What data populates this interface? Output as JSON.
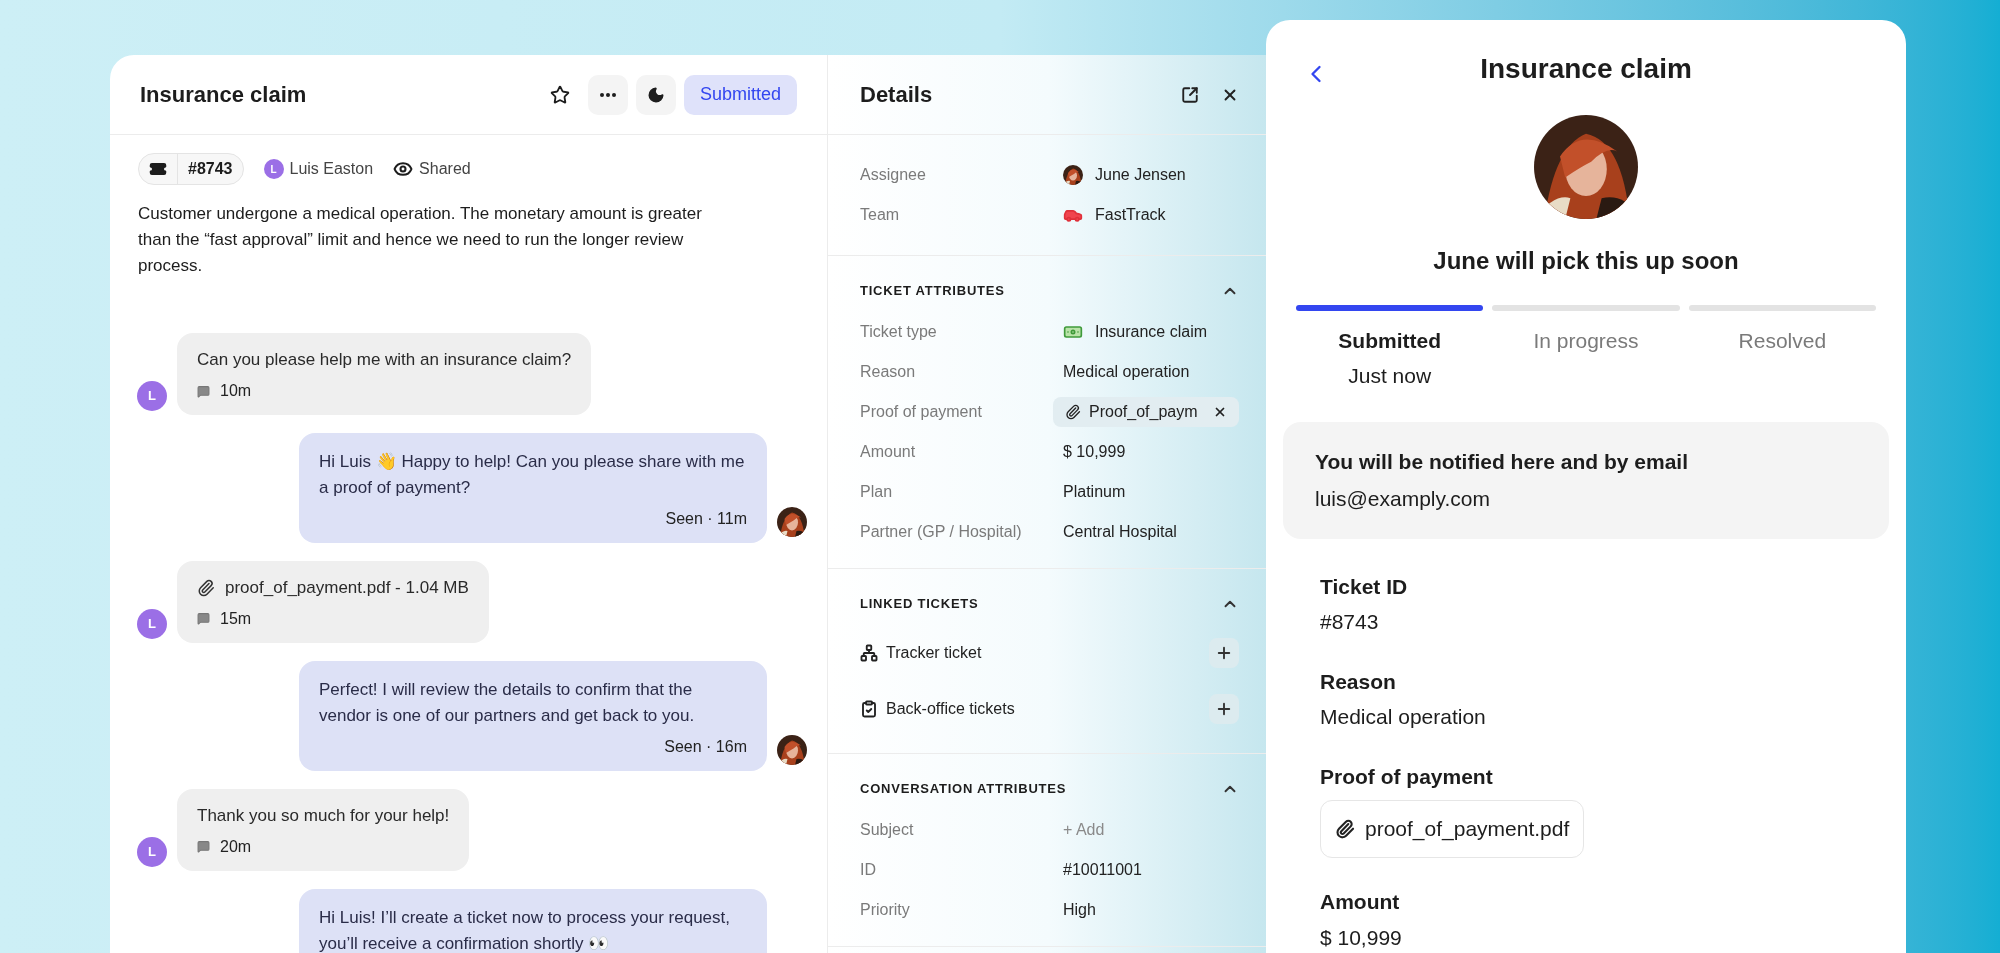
{
  "ticket": {
    "title": "Insurance claim",
    "status_button": "Submitted",
    "id": "#8743",
    "requester": {
      "initial": "L",
      "name": "Luis Easton"
    },
    "visibility": "Shared",
    "starred": false,
    "description": "Customer undergone a medical operation. The monetary amount is greater than the “fast approval” limit and hence we need to run the longer review process."
  },
  "messages": [
    {
      "kind": "customer",
      "avatar": "L",
      "text": "Can you please help me with an insurance claim?",
      "time": "10m"
    },
    {
      "kind": "agent",
      "text": "Hi Luis 👋 Happy to help! Can you please share with me a proof of payment?",
      "meta": "Seen · 11m"
    },
    {
      "kind": "attachment",
      "avatar": "L",
      "text": "proof_of_payment.pdf - 1.04 MB",
      "time": "15m"
    },
    {
      "kind": "agent",
      "text": "Perfect! I will review the details to confirm that the vendor is one of our partners and get back to you.",
      "meta": "Seen · 16m"
    },
    {
      "kind": "customer",
      "avatar": "L",
      "text": "Thank you so much for your help!",
      "time": "20m"
    },
    {
      "kind": "agent",
      "text": "Hi Luis! I’ll create a ticket now to process your request, you’ll receive a confirmation shortly 👀"
    }
  ],
  "details": {
    "title": "Details",
    "people": [
      {
        "label": "Assignee",
        "value": "June Jensen",
        "kind": "avatar"
      },
      {
        "label": "Team",
        "value": "FastTrack",
        "kind": "vehicle"
      }
    ],
    "sections": [
      {
        "title": "TICKET ATTRIBUTES",
        "expanded": true,
        "rows": [
          {
            "label": "Ticket type",
            "value": "Insurance claim",
            "kind": "money"
          },
          {
            "label": "Reason",
            "value": "Medical operation",
            "kind": "text"
          },
          {
            "label": "Proof of payment",
            "value": "Proof_of_paym",
            "kind": "file"
          },
          {
            "label": "Amount",
            "value": "$ 10,999",
            "kind": "text"
          },
          {
            "label": "Plan",
            "value": "Platinum",
            "kind": "text"
          },
          {
            "label": "Partner (GP / Hospital)",
            "value": "Central Hospital",
            "kind": "text"
          }
        ]
      },
      {
        "title": "LINKED TICKETS",
        "expanded": true,
        "links": [
          {
            "label": "Tracker ticket",
            "kind": "tree"
          },
          {
            "label": "Back-office tickets",
            "kind": "clipboard"
          }
        ]
      },
      {
        "title": "CONVERSATION ATTRIBUTES",
        "expanded": true,
        "rows": [
          {
            "label": "Subject",
            "value": "+ Add",
            "kind": "action"
          },
          {
            "label": "ID",
            "value": "#10011001",
            "kind": "text"
          },
          {
            "label": "Priority",
            "value": "High",
            "kind": "text"
          }
        ]
      }
    ]
  },
  "portal": {
    "title": "Insurance claim",
    "headline": "June will pick this up soon",
    "steps": [
      {
        "label": "Submitted",
        "time": "Just now",
        "selected": true
      },
      {
        "label": "In progress",
        "selected": false
      },
      {
        "label": "Resolved",
        "selected": false
      }
    ],
    "notice": {
      "title": "You will be notified here and by email",
      "email": "luis@examply.com"
    },
    "fields": [
      {
        "label": "Ticket ID",
        "value": "#8743",
        "kind": "text"
      },
      {
        "label": "Reason",
        "value": "Medical operation",
        "kind": "text"
      },
      {
        "label": "Proof of payment",
        "value": "proof_of_payment.pdf",
        "kind": "file"
      },
      {
        "label": "Amount",
        "value": "$ 10,999",
        "kind": "text"
      }
    ]
  }
}
